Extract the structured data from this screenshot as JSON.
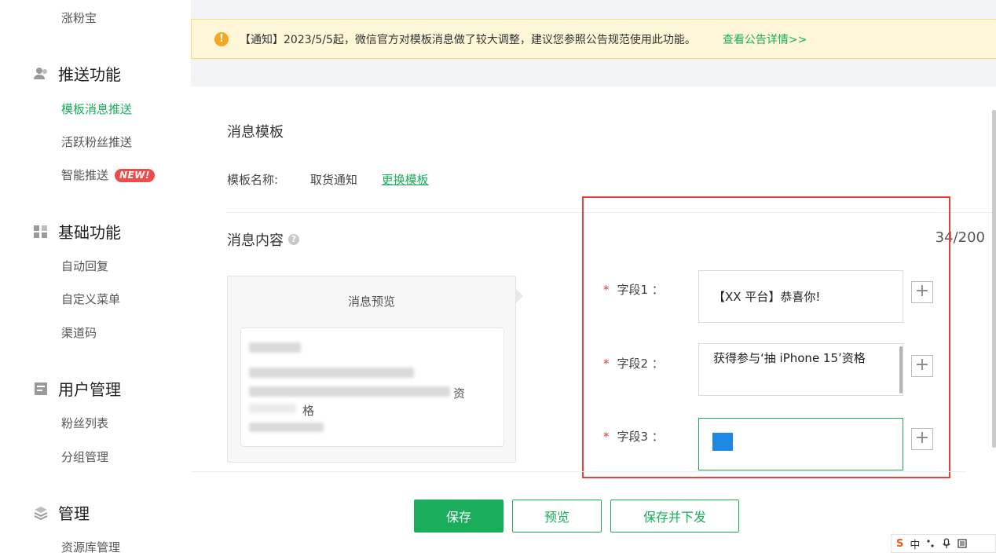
{
  "sidebar": {
    "top_item": "涨粉宝",
    "sections": [
      {
        "title": "推送功能",
        "items": [
          "模板消息推送",
          "活跃粉丝推送",
          "智能推送"
        ]
      },
      {
        "title": "基础功能",
        "items": [
          "自动回复",
          "自定义菜单",
          "渠道码"
        ]
      },
      {
        "title": "用户管理",
        "items": [
          "粉丝列表",
          "分组管理"
        ]
      },
      {
        "title": "管理",
        "items": [
          "资源库管理"
        ]
      }
    ],
    "new_badge": "NEW!"
  },
  "notice": {
    "text": "【通知】2023/5/5起，微信官方对模板消息做了较大调整，建议您参照公告规范使用此功能。",
    "link": "查看公告详情>>"
  },
  "main": {
    "title": "消息模板",
    "template_label": "模板名称:",
    "template_value": "取货通知",
    "change_template": "更换模板",
    "content_title": "消息内容",
    "counter": "34/200",
    "preview": {
      "title": "消息预览",
      "visible_char1": "资",
      "visible_char2": "格"
    },
    "fields": [
      {
        "label": "字段1 ：",
        "value": "【XX 平台】恭喜你!"
      },
      {
        "label": "字段2 ：",
        "value": "获得参与‘抽 iPhone 15’资格"
      },
      {
        "label": "字段3 ：",
        "value": ""
      }
    ],
    "required_mark": "*",
    "plus": "+"
  },
  "buttons": {
    "save": "保存",
    "preview": "预览",
    "save_send": "保存并下发"
  },
  "ime": {
    "logo": "S",
    "lang": "中"
  },
  "colors": {
    "accent": "#1aad5b",
    "highlight": "#e53f3f",
    "notice_bg": "#fdf6d7"
  }
}
